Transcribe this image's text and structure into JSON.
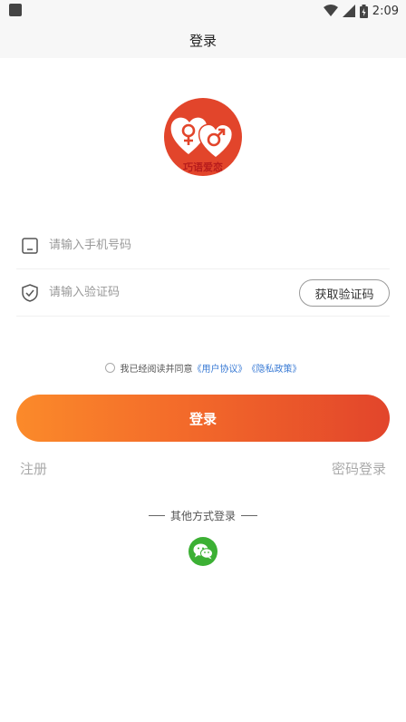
{
  "status_bar": {
    "time": "2:09"
  },
  "header": {
    "title": "登录"
  },
  "logo": {
    "text": "巧语爱恋"
  },
  "phone_field": {
    "placeholder": "请输入手机号码",
    "icon": "phone-icon"
  },
  "code_field": {
    "placeholder": "请输入验证码",
    "icon": "shield-icon",
    "button_label": "获取验证码"
  },
  "agreement": {
    "prefix": "我已经阅读并同意",
    "user_agreement": "《用户协议》",
    "privacy_policy": "《隐私政策》"
  },
  "login_button": {
    "label": "登录"
  },
  "links": {
    "register": "注册",
    "password_login": "密码登录"
  },
  "other_login": {
    "title": "其他方式登录",
    "wechat_icon": "wechat-icon"
  },
  "colors": {
    "accent_start": "#fb8a2a",
    "accent_end": "#e2452b",
    "link": "#3a7bd5",
    "wechat": "#3cb034"
  }
}
